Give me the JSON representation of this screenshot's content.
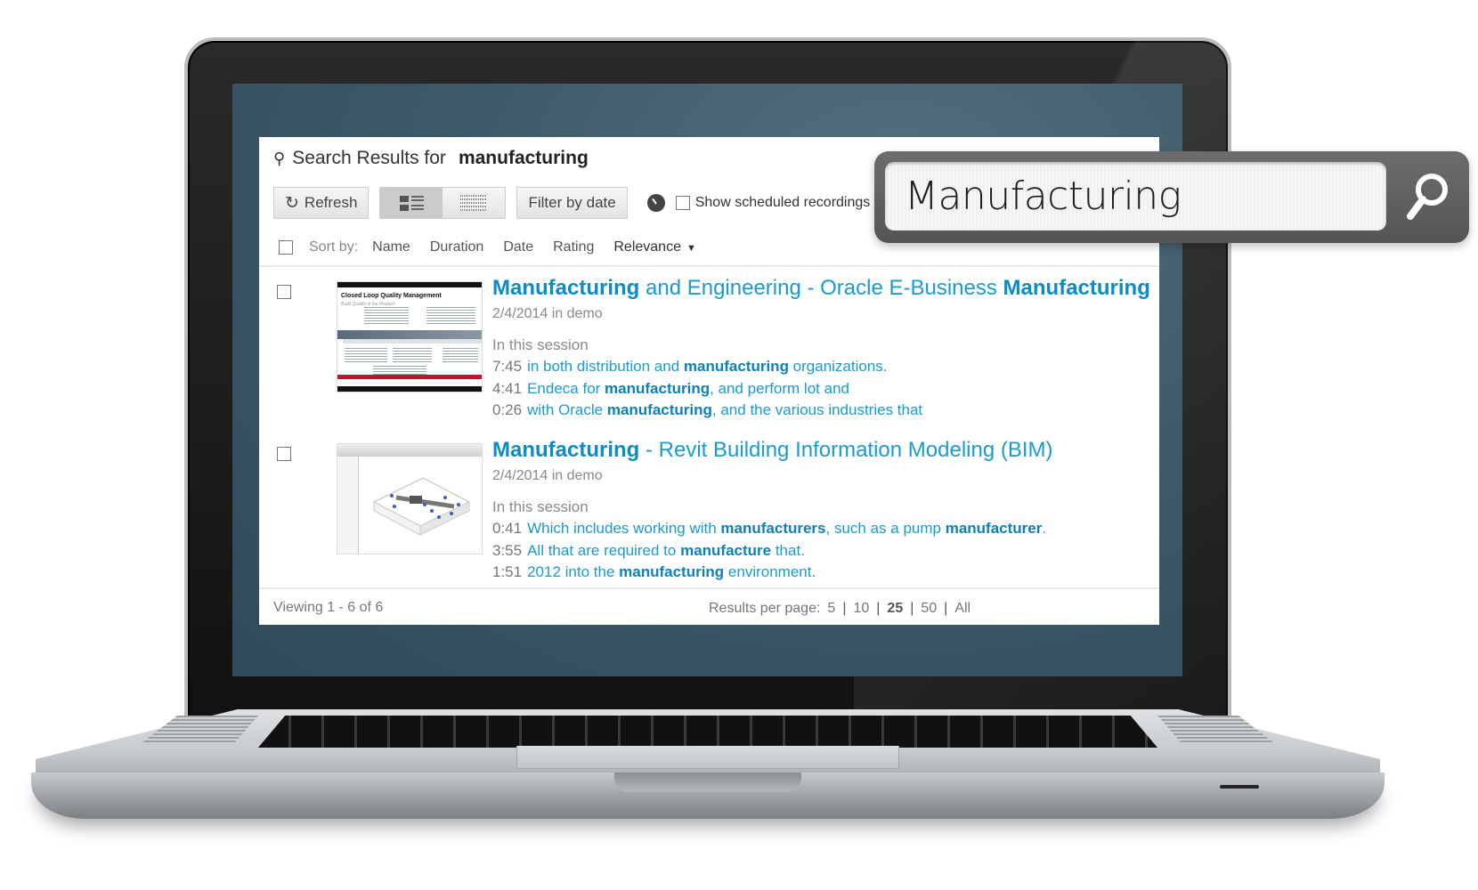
{
  "app": {
    "title_prefix": "Search Results for",
    "query": "manufacturing",
    "toolbar": {
      "refresh_label": "Refresh",
      "filter_label": "Filter by date",
      "show_scheduled_label": "Show scheduled recordings",
      "show_scheduled_checked": false,
      "view_modes": [
        "list",
        "grid"
      ],
      "active_view": "list"
    },
    "sort": {
      "label": "Sort by:",
      "options": [
        "Name",
        "Duration",
        "Date",
        "Rating",
        "Relevance"
      ],
      "active": "Relevance"
    },
    "results": [
      {
        "title_parts": [
          {
            "text": "Manufacturing",
            "bold": true
          },
          {
            "text": " and Engineering - Oracle E-Business ",
            "bold": false
          },
          {
            "text": "Manufacturing",
            "bold": true
          }
        ],
        "meta": "2/4/2014 in demo",
        "session_label": "In this session",
        "thumbnail_title": "Closed Loop Quality Management",
        "thumbnail_subtitle": "Build Quality in the Product",
        "snippets": [
          {
            "time": "7:45",
            "parts": [
              {
                "t": "in both distribution and ",
                "b": false
              },
              {
                "t": "manufacturing",
                "b": true
              },
              {
                "t": " organizations.",
                "b": false
              }
            ]
          },
          {
            "time": "4:41",
            "parts": [
              {
                "t": "Endeca for ",
                "b": false
              },
              {
                "t": "manufacturing",
                "b": true
              },
              {
                "t": ", and perform lot and",
                "b": false
              }
            ]
          },
          {
            "time": "0:26",
            "parts": [
              {
                "t": "with Oracle ",
                "b": false
              },
              {
                "t": "manufacturing",
                "b": true
              },
              {
                "t": ", and the various industries that",
                "b": false
              }
            ]
          }
        ]
      },
      {
        "title_parts": [
          {
            "text": "Manufacturing",
            "bold": true
          },
          {
            "text": " - Revit Building Information Modeling (BIM)",
            "bold": false
          }
        ],
        "meta": "2/4/2014 in demo",
        "session_label": "In this session",
        "snippets": [
          {
            "time": "0:41",
            "parts": [
              {
                "t": "Which includes working with ",
                "b": false
              },
              {
                "t": "manufacturers",
                "b": true
              },
              {
                "t": ", such as a pump ",
                "b": false
              },
              {
                "t": "manufacturer",
                "b": true
              },
              {
                "t": ".",
                "b": false
              }
            ]
          },
          {
            "time": "3:55",
            "parts": [
              {
                "t": "All that are required to ",
                "b": false
              },
              {
                "t": "manufacture",
                "b": true
              },
              {
                "t": " that.",
                "b": false
              }
            ]
          },
          {
            "time": "1:51",
            "parts": [
              {
                "t": "2012 into the ",
                "b": false
              },
              {
                "t": "manufacturing",
                "b": true
              },
              {
                "t": " environment.",
                "b": false
              }
            ]
          }
        ]
      }
    ],
    "footer": {
      "viewing": "Viewing 1 - 6 of 6",
      "rpp_label": "Results per page:",
      "rpp_options": [
        "5",
        "10",
        "25",
        "50",
        "All"
      ],
      "rpp_active": "25"
    }
  },
  "floating_search": {
    "value": "Manufacturing",
    "icon": "search-icon"
  },
  "colors": {
    "link": "#1a9bd0",
    "link_bold": "#0d8cc4",
    "screen_bg": "#3f5a69"
  }
}
